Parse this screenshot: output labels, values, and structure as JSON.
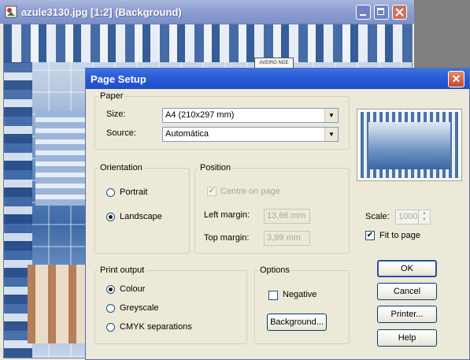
{
  "bg_window": {
    "title": "azule3130.jpg [1:2] (Background)",
    "sign_text": "AVEIRO NOE"
  },
  "dialog": {
    "title": "Page Setup",
    "close_glyph": "✕",
    "paper": {
      "legend": "Paper",
      "size_label": "Size:",
      "size_value": "A4 (210x297 mm)",
      "source_label": "Source:",
      "source_value": "Automática"
    },
    "orientation": {
      "legend": "Orientation",
      "portrait": "Portrait",
      "landscape": "Landscape",
      "selected": "landscape"
    },
    "position": {
      "legend": "Position",
      "centre_on_page": "Centre on page",
      "left_margin_label": "Left margin:",
      "left_margin_value": "13,66 mm",
      "top_margin_label": "Top margin:",
      "top_margin_value": "3,99 mm"
    },
    "scale": {
      "label": "Scale:",
      "value": "1000",
      "fit_to_page": "Fit to page",
      "fit_checked": true
    },
    "print_output": {
      "legend": "Print output",
      "colour": "Colour",
      "greyscale": "Greyscale",
      "cmyk": "CMYK separations",
      "selected": "colour"
    },
    "options": {
      "legend": "Options",
      "negative": "Negative",
      "background_button": "Background..."
    },
    "buttons": {
      "ok": "OK",
      "cancel": "Cancel",
      "printer": "Printer...",
      "help": "Help"
    }
  }
}
